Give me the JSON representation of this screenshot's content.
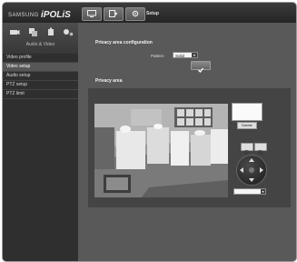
{
  "header": {
    "brand_prefix": "SAMSUNG",
    "brand_name": "iPOLiS",
    "tabs": [
      {
        "icon": "monitor-icon"
      },
      {
        "icon": "playback-icon"
      },
      {
        "icon": "setup-gear-icon"
      }
    ],
    "current_section": "Setup"
  },
  "sidebar": {
    "category_icons": [
      "camera-icon",
      "network-icon",
      "event-icon",
      "system-icon"
    ],
    "category_label": "Audio & Video",
    "items": [
      {
        "label": "Video profile",
        "active": false
      },
      {
        "label": "Video setup",
        "active": true
      },
      {
        "label": "Audio setup",
        "active": false
      },
      {
        "label": "PTZ setup",
        "active": false
      },
      {
        "label": "PTZ limit",
        "active": false
      }
    ]
  },
  "main": {
    "config_title": "Privacy area configuration",
    "pattern_label": "Pattern",
    "pattern_value": "Solid",
    "apply_icon": "check-icon",
    "area_title": "Privacy area",
    "delete_label": "Delete",
    "zoom_in_icon": "zoom-in-icon",
    "zoom_out_icon": "zoom-out-icon"
  },
  "colors": {
    "background": "#595959",
    "sidebar": "#2f2f2f",
    "topbar": "#2b2b2b",
    "active_item": "#575757"
  }
}
